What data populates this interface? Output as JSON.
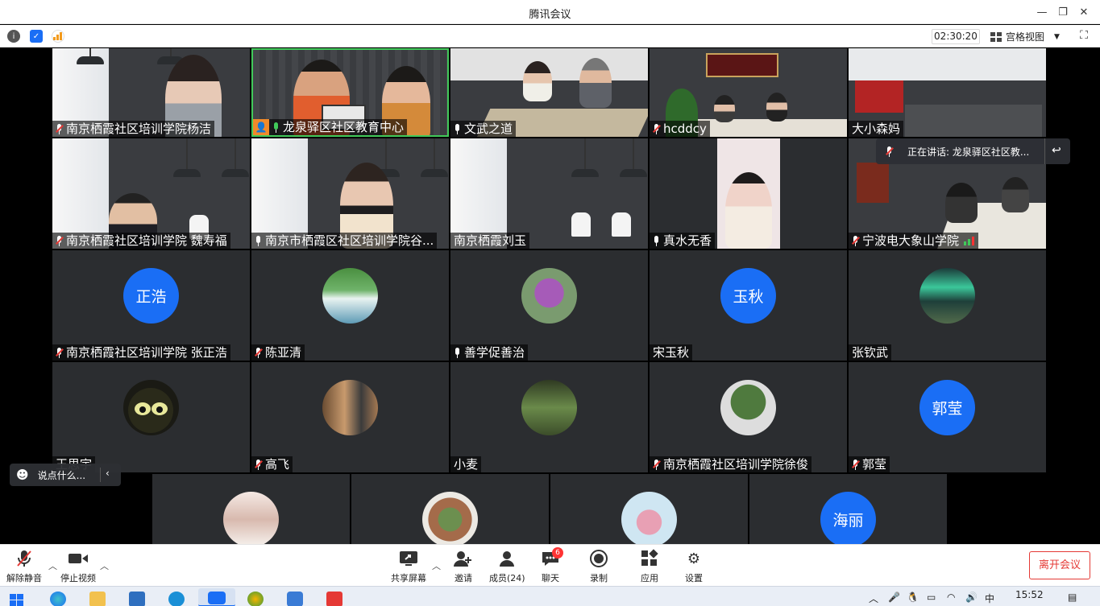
{
  "window": {
    "title": "腾讯会议"
  },
  "infobar": {
    "timer": "02:30:20",
    "view_label": "宫格视图"
  },
  "tiles_row1": [
    {
      "name": "南京栖霞社区培训学院杨洁",
      "mic": "muted"
    },
    {
      "name": "龙泉驿区社区教育中心",
      "mic": "speaking",
      "host": true
    },
    {
      "name": "文武之道",
      "mic": "on"
    },
    {
      "name": "hcddcy",
      "mic": "muted"
    },
    {
      "name": "大小森妈",
      "mic": "none"
    }
  ],
  "tiles_row2": [
    {
      "name": "南京栖霞社区培训学院 魏寿福",
      "mic": "muted"
    },
    {
      "name": "南京市栖霞区社区培训学院谷...",
      "mic": "on"
    },
    {
      "name": "南京栖霞刘玉",
      "mic": "none"
    },
    {
      "name": "真水无香",
      "mic": "on"
    },
    {
      "name": "宁波电大象山学院",
      "mic": "muted"
    }
  ],
  "tiles_row3": [
    {
      "name": "南京栖霞社区培训学院 张正浩",
      "mic": "muted",
      "avatar_text": "正浩"
    },
    {
      "name": "陈亚清",
      "mic": "muted",
      "avatar_icon": "waterfall-avatar"
    },
    {
      "name": "善学促善治",
      "mic": "on",
      "avatar_icon": "flower-avatar"
    },
    {
      "name": "宋玉秋",
      "mic": "none",
      "avatar_text": "玉秋"
    },
    {
      "name": "张钦武",
      "mic": "none",
      "avatar_icon": "aurora-avatar"
    }
  ],
  "tiles_row4": [
    {
      "name": "王思宇",
      "mic": "none",
      "avatar_icon": "cartoon-avatar"
    },
    {
      "name": "高飞",
      "mic": "muted",
      "avatar_icon": "window-avatar"
    },
    {
      "name": "小麦",
      "mic": "none",
      "avatar_icon": "field-avatar"
    },
    {
      "name": "南京栖霞社区培训学院徐俊",
      "mic": "muted",
      "avatar_icon": "plant-avatar"
    },
    {
      "name": "郭莹",
      "mic": "muted",
      "avatar_text": "郭莹"
    }
  ],
  "tiles_row5": [
    {
      "avatar_icon": "wedding-avatar"
    },
    {
      "avatar_icon": "succulent-avatar"
    },
    {
      "avatar_icon": "child-avatar"
    },
    {
      "avatar_text": "海丽"
    }
  ],
  "speaking": {
    "label": "正在讲话: 龙泉驿区社区教..."
  },
  "chat": {
    "placeholder": "说点什么..."
  },
  "toolbar": {
    "unmute": "解除静音",
    "stop_video": "停止视频",
    "share_screen": "共享屏幕",
    "invite": "邀请",
    "members": "成员(24)",
    "chat": "聊天",
    "chat_badge": "6",
    "record": "录制",
    "apps": "应用",
    "settings": "设置",
    "leave": "离开会议"
  },
  "taskbar": {
    "clock": "15:52",
    "ime": "中"
  },
  "colors": {
    "accent": "#1a6ef5",
    "danger": "#e53935",
    "mic_active": "#41c95a"
  }
}
